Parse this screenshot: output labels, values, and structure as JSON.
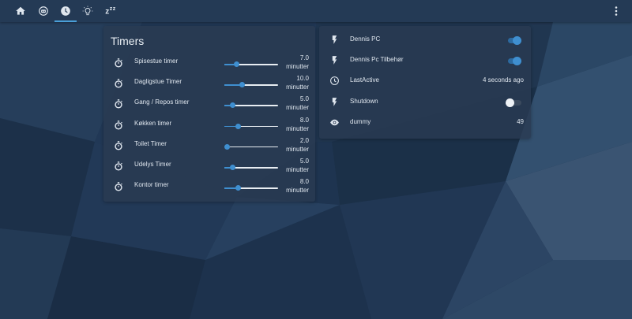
{
  "toolbar": {
    "tabs": [
      {
        "icon": "home-icon"
      },
      {
        "icon": "robot-icon"
      },
      {
        "icon": "clock-icon",
        "active": true
      },
      {
        "icon": "lightbulb-icon"
      },
      {
        "icon": "sleep-icon",
        "text": "z",
        "sup": "z"
      }
    ],
    "menu_icon": "dots-vertical-icon"
  },
  "timers": {
    "title": "Timers",
    "items": [
      {
        "name": "Spisestue timer",
        "value": "7.0",
        "unit": "minutter",
        "level": 0.23
      },
      {
        "name": "Dagligstue Timer",
        "value": "10.0",
        "unit": "minutter",
        "level": 0.33
      },
      {
        "name": "Gang / Repos timer",
        "value": "5.0",
        "unit": "minutter",
        "level": 0.15
      },
      {
        "name": "Køkken timer",
        "value": "8.0",
        "unit": "minutter",
        "level": 0.26
      },
      {
        "name": "Toilet Timer",
        "value": "2.0",
        "unit": "minutter",
        "level": 0.05
      },
      {
        "name": "Udelys Timer",
        "value": "5.0",
        "unit": "minutter",
        "level": 0.15
      },
      {
        "name": "Kontor timer",
        "value": "8.0",
        "unit": "minutter",
        "level": 0.26
      }
    ]
  },
  "status": {
    "items": [
      {
        "icon": "flash-icon",
        "name": "Dennis PC",
        "type": "toggle",
        "on": true
      },
      {
        "icon": "flash-icon",
        "name": "Dennis Pc Tilbehør",
        "type": "toggle",
        "on": true
      },
      {
        "icon": "clock-icon",
        "name": "LastActive",
        "type": "text",
        "state": "4 seconds ago"
      },
      {
        "icon": "flash-icon",
        "name": "Shutdown",
        "type": "toggle",
        "on": false
      },
      {
        "icon": "eye-icon",
        "name": "dummy",
        "type": "text",
        "state": "49"
      }
    ]
  },
  "colors": {
    "accent": "#3f8fd0",
    "toolbar": "#243a55",
    "card": "#2a3a52"
  }
}
